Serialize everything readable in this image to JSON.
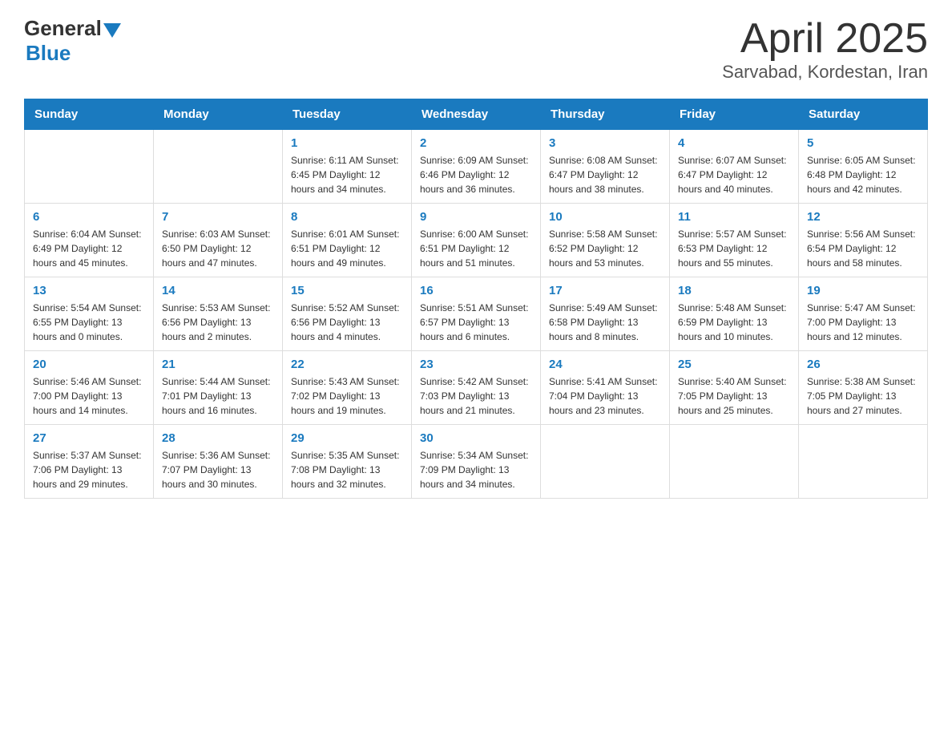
{
  "header": {
    "logo": {
      "general": "General",
      "blue": "Blue"
    },
    "title": "April 2025",
    "subtitle": "Sarvabad, Kordestan, Iran"
  },
  "days_of_week": [
    "Sunday",
    "Monday",
    "Tuesday",
    "Wednesday",
    "Thursday",
    "Friday",
    "Saturday"
  ],
  "weeks": [
    [
      {
        "num": "",
        "info": ""
      },
      {
        "num": "",
        "info": ""
      },
      {
        "num": "1",
        "info": "Sunrise: 6:11 AM\nSunset: 6:45 PM\nDaylight: 12 hours\nand 34 minutes."
      },
      {
        "num": "2",
        "info": "Sunrise: 6:09 AM\nSunset: 6:46 PM\nDaylight: 12 hours\nand 36 minutes."
      },
      {
        "num": "3",
        "info": "Sunrise: 6:08 AM\nSunset: 6:47 PM\nDaylight: 12 hours\nand 38 minutes."
      },
      {
        "num": "4",
        "info": "Sunrise: 6:07 AM\nSunset: 6:47 PM\nDaylight: 12 hours\nand 40 minutes."
      },
      {
        "num": "5",
        "info": "Sunrise: 6:05 AM\nSunset: 6:48 PM\nDaylight: 12 hours\nand 42 minutes."
      }
    ],
    [
      {
        "num": "6",
        "info": "Sunrise: 6:04 AM\nSunset: 6:49 PM\nDaylight: 12 hours\nand 45 minutes."
      },
      {
        "num": "7",
        "info": "Sunrise: 6:03 AM\nSunset: 6:50 PM\nDaylight: 12 hours\nand 47 minutes."
      },
      {
        "num": "8",
        "info": "Sunrise: 6:01 AM\nSunset: 6:51 PM\nDaylight: 12 hours\nand 49 minutes."
      },
      {
        "num": "9",
        "info": "Sunrise: 6:00 AM\nSunset: 6:51 PM\nDaylight: 12 hours\nand 51 minutes."
      },
      {
        "num": "10",
        "info": "Sunrise: 5:58 AM\nSunset: 6:52 PM\nDaylight: 12 hours\nand 53 minutes."
      },
      {
        "num": "11",
        "info": "Sunrise: 5:57 AM\nSunset: 6:53 PM\nDaylight: 12 hours\nand 55 minutes."
      },
      {
        "num": "12",
        "info": "Sunrise: 5:56 AM\nSunset: 6:54 PM\nDaylight: 12 hours\nand 58 minutes."
      }
    ],
    [
      {
        "num": "13",
        "info": "Sunrise: 5:54 AM\nSunset: 6:55 PM\nDaylight: 13 hours\nand 0 minutes."
      },
      {
        "num": "14",
        "info": "Sunrise: 5:53 AM\nSunset: 6:56 PM\nDaylight: 13 hours\nand 2 minutes."
      },
      {
        "num": "15",
        "info": "Sunrise: 5:52 AM\nSunset: 6:56 PM\nDaylight: 13 hours\nand 4 minutes."
      },
      {
        "num": "16",
        "info": "Sunrise: 5:51 AM\nSunset: 6:57 PM\nDaylight: 13 hours\nand 6 minutes."
      },
      {
        "num": "17",
        "info": "Sunrise: 5:49 AM\nSunset: 6:58 PM\nDaylight: 13 hours\nand 8 minutes."
      },
      {
        "num": "18",
        "info": "Sunrise: 5:48 AM\nSunset: 6:59 PM\nDaylight: 13 hours\nand 10 minutes."
      },
      {
        "num": "19",
        "info": "Sunrise: 5:47 AM\nSunset: 7:00 PM\nDaylight: 13 hours\nand 12 minutes."
      }
    ],
    [
      {
        "num": "20",
        "info": "Sunrise: 5:46 AM\nSunset: 7:00 PM\nDaylight: 13 hours\nand 14 minutes."
      },
      {
        "num": "21",
        "info": "Sunrise: 5:44 AM\nSunset: 7:01 PM\nDaylight: 13 hours\nand 16 minutes."
      },
      {
        "num": "22",
        "info": "Sunrise: 5:43 AM\nSunset: 7:02 PM\nDaylight: 13 hours\nand 19 minutes."
      },
      {
        "num": "23",
        "info": "Sunrise: 5:42 AM\nSunset: 7:03 PM\nDaylight: 13 hours\nand 21 minutes."
      },
      {
        "num": "24",
        "info": "Sunrise: 5:41 AM\nSunset: 7:04 PM\nDaylight: 13 hours\nand 23 minutes."
      },
      {
        "num": "25",
        "info": "Sunrise: 5:40 AM\nSunset: 7:05 PM\nDaylight: 13 hours\nand 25 minutes."
      },
      {
        "num": "26",
        "info": "Sunrise: 5:38 AM\nSunset: 7:05 PM\nDaylight: 13 hours\nand 27 minutes."
      }
    ],
    [
      {
        "num": "27",
        "info": "Sunrise: 5:37 AM\nSunset: 7:06 PM\nDaylight: 13 hours\nand 29 minutes."
      },
      {
        "num": "28",
        "info": "Sunrise: 5:36 AM\nSunset: 7:07 PM\nDaylight: 13 hours\nand 30 minutes."
      },
      {
        "num": "29",
        "info": "Sunrise: 5:35 AM\nSunset: 7:08 PM\nDaylight: 13 hours\nand 32 minutes."
      },
      {
        "num": "30",
        "info": "Sunrise: 5:34 AM\nSunset: 7:09 PM\nDaylight: 13 hours\nand 34 minutes."
      },
      {
        "num": "",
        "info": ""
      },
      {
        "num": "",
        "info": ""
      },
      {
        "num": "",
        "info": ""
      }
    ]
  ]
}
